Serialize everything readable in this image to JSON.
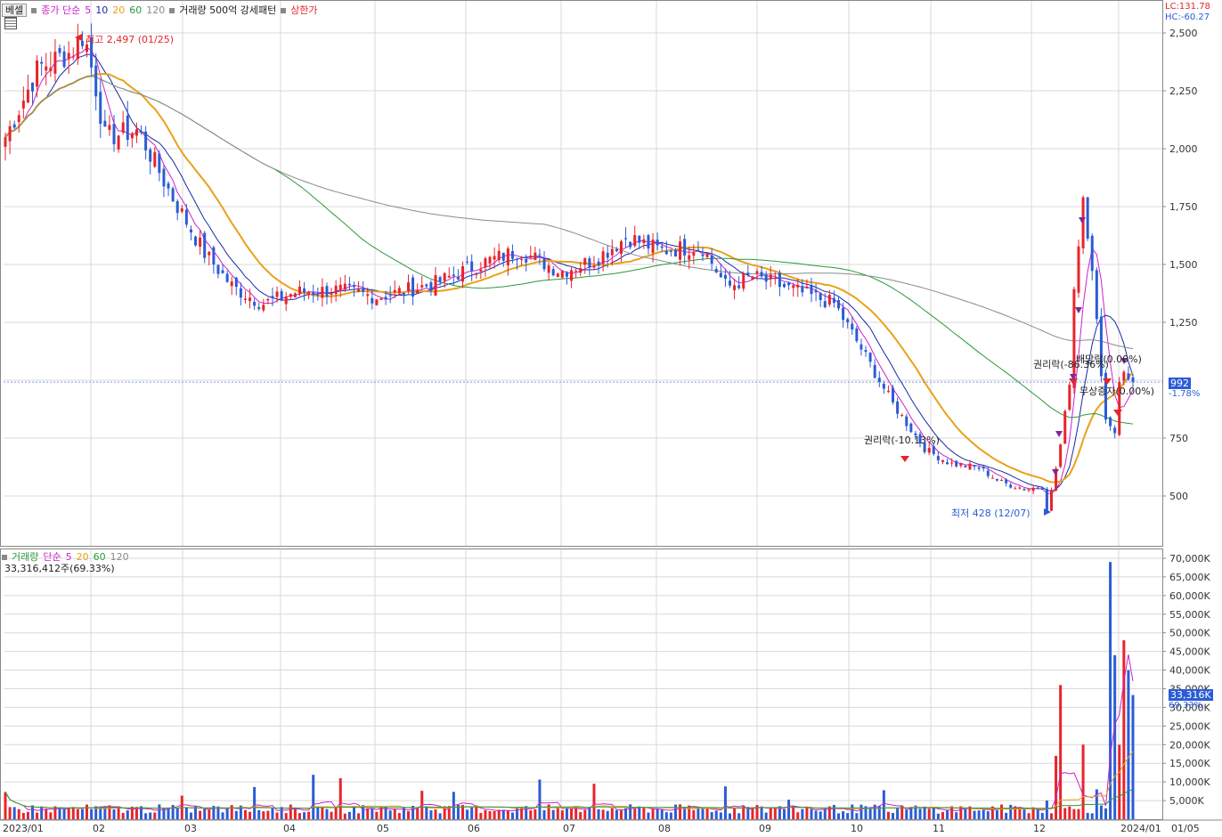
{
  "header": {
    "panel_button": "베셀",
    "ma_label": "종가 단순",
    "ma_periods": [
      "5",
      "10",
      "20",
      "60",
      "120"
    ],
    "volume_pattern": "거래량 500억 강세패턴",
    "limit_up": "상한가",
    "lc": "LC:131.78",
    "hc": "HC:-60.27"
  },
  "volume_legend": {
    "title": "거래량",
    "ma_label": "단순",
    "periods": [
      "5",
      "20",
      "60",
      "120"
    ],
    "current": "33,316,412주(69.33%)"
  },
  "price_tag": {
    "value": "992",
    "change": "-1.78%"
  },
  "volume_tag": {
    "value": "33,316K",
    "change": "69.33%"
  },
  "annotations": {
    "high": "최고 2,497 (01/25)",
    "low": "최저 428 (12/07)",
    "rights_oct": "권리락(-10.13%)",
    "rights_dec": "권리락(-86.36%)",
    "dividend_dec": "배당락(0.00%)",
    "bonus_dec": "무상증자(0.00%)"
  },
  "x_axis_labels": [
    "2023/01",
    "02",
    "03",
    "04",
    "05",
    "06",
    "07",
    "08",
    "09",
    "10",
    "11",
    "12",
    "2024/01",
    "01/05"
  ],
  "price_axis": [
    "2,500",
    "2,250",
    "2,000",
    "1,750",
    "1,500",
    "1,250",
    "992",
    "750",
    "500"
  ],
  "volume_axis": [
    "70,000K",
    "65,000K",
    "60,000K",
    "55,000K",
    "50,000K",
    "45,000K",
    "40,000K",
    "35,000K",
    "30,000K",
    "25,000K",
    "20,000K",
    "15,000K",
    "10,000K",
    "5,000K"
  ],
  "colors": {
    "up": "#e8242a",
    "down": "#2a5cd6",
    "ma5": "#cc22cc",
    "ma10": "#1a2aa8",
    "ma20": "#e8a21a",
    "ma60": "#2a9a3a",
    "ma120": "#8a8a8a",
    "grid": "#d8d8d8"
  },
  "chart_data": {
    "type": "candlestick",
    "title": "",
    "x": [
      "2023/01",
      "02",
      "03",
      "04",
      "05",
      "06",
      "07",
      "08",
      "09",
      "10",
      "11",
      "12",
      "2024/01"
    ],
    "close_approx": [
      2300,
      2050,
      1400,
      1380,
      1450,
      1500,
      1550,
      1380,
      1100,
      620,
      520,
      440,
      992
    ],
    "high": {
      "value": 2497,
      "date": "01/25"
    },
    "low": {
      "value": 428,
      "date": "12/07"
    },
    "last_close": 992,
    "last_change_pct": -1.78,
    "last_volume_thousands": 33316,
    "last_volume_ratio_pct": 69.33,
    "y_price_range": [
      390,
      2600
    ],
    "y_volume_range": [
      0,
      72000
    ],
    "ma_periods": [
      5,
      10,
      20,
      60,
      120
    ],
    "grid": true
  }
}
